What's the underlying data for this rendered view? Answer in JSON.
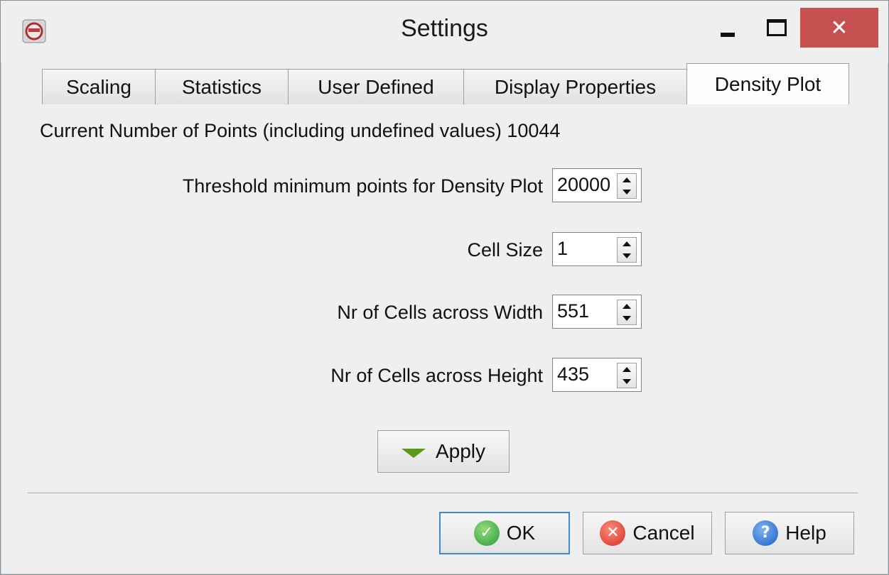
{
  "window": {
    "title": "Settings",
    "close_glyph": "✕"
  },
  "tabs": [
    {
      "label": "Scaling",
      "active": false
    },
    {
      "label": "Statistics",
      "active": false
    },
    {
      "label": "User Defined",
      "active": false
    },
    {
      "label": "Display Properties",
      "active": false
    },
    {
      "label": "Density Plot",
      "active": true
    }
  ],
  "density": {
    "points_text": "Current Number of Points (including undefined values) 10044",
    "fields": [
      {
        "label": "Threshold minimum points for Density Plot",
        "value": "20000"
      },
      {
        "label": "Cell Size",
        "value": "1"
      },
      {
        "label": "Nr of Cells across Width",
        "value": "551"
      },
      {
        "label": "Nr of Cells across Height",
        "value": "435"
      }
    ],
    "apply_label": "Apply"
  },
  "buttons": {
    "ok": "OK",
    "cancel": "Cancel",
    "help": "Help"
  },
  "icons": {
    "app": "app-icon",
    "apply": "green-down-triangle-icon",
    "ok": "check-icon",
    "cancel": "cross-icon",
    "help": "question-icon"
  },
  "colors": {
    "close_button": "#c75050",
    "ok_icon": "#2e9a3a",
    "cancel_icon": "#d22f22",
    "help_icon": "#1a5fc2",
    "apply_icon": "#5a9a1a",
    "focus_border": "#3c8ad6"
  }
}
